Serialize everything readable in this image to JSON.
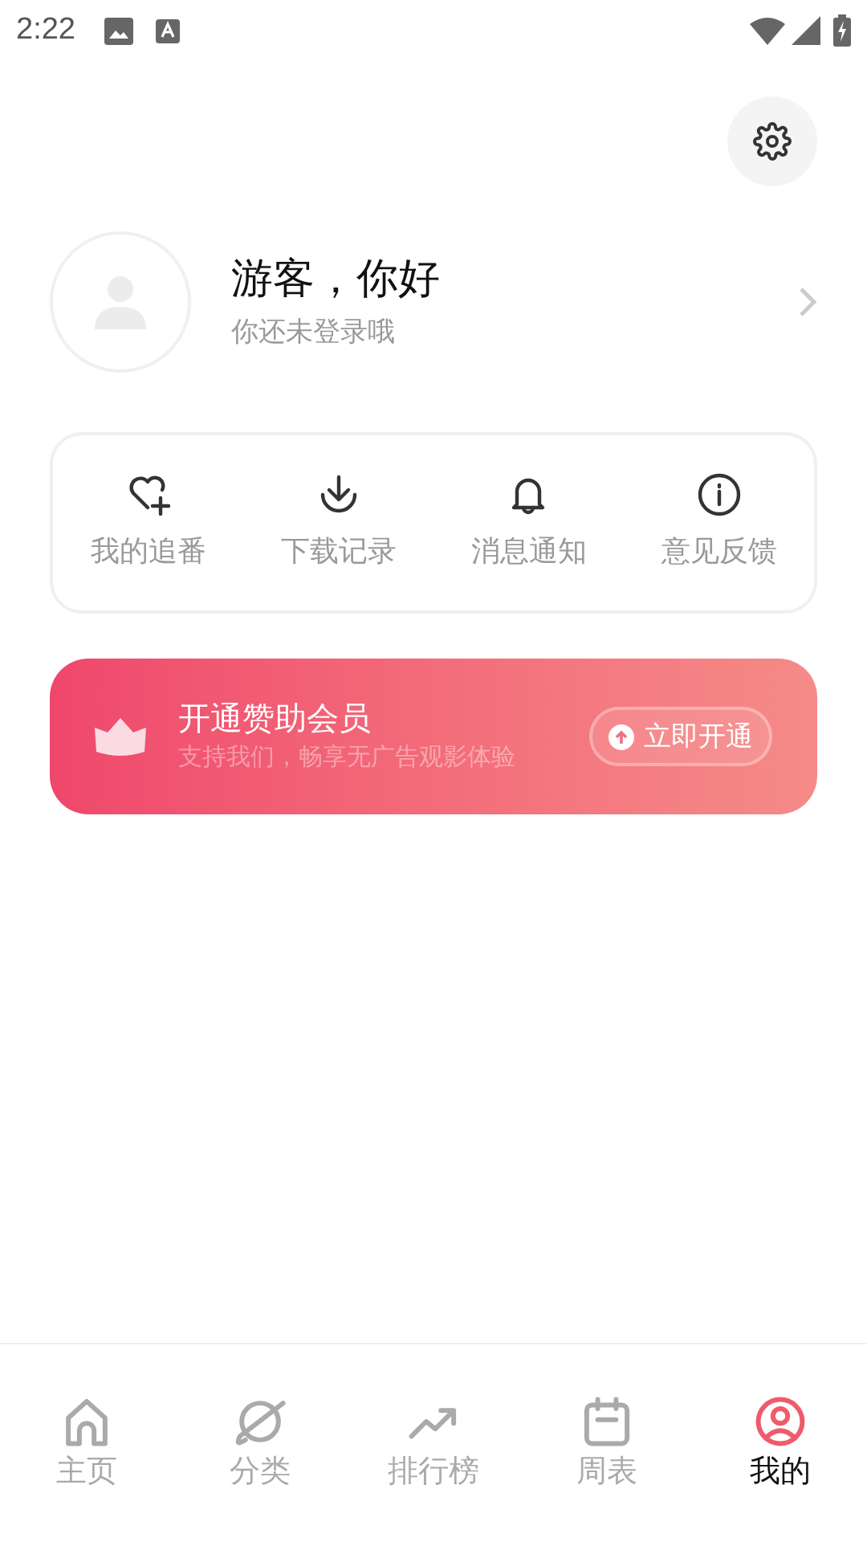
{
  "status_bar": {
    "time": "2:22"
  },
  "profile": {
    "name": "游客，你好",
    "subtitle": "你还未登录哦"
  },
  "shortcuts": [
    {
      "label": "我的追番"
    },
    {
      "label": "下载记录"
    },
    {
      "label": "消息通知"
    },
    {
      "label": "意见反馈"
    }
  ],
  "vip_banner": {
    "title": "开通赞助会员",
    "subtitle": "支持我们，畅享无广告观影体验",
    "button": "立即开通"
  },
  "bottom_nav": [
    {
      "label": "主页",
      "selected": false
    },
    {
      "label": "分类",
      "selected": false
    },
    {
      "label": "排行榜",
      "selected": false
    },
    {
      "label": "周表",
      "selected": false
    },
    {
      "label": "我的",
      "selected": true
    }
  ]
}
